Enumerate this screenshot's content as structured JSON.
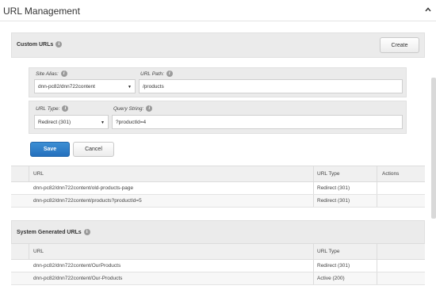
{
  "header": {
    "title": "URL Management"
  },
  "custom_urls": {
    "title": "Custom URLs",
    "create_label": "Create",
    "site_alias": {
      "label": "Site Alias:",
      "value": "dnn-pc82/dnn722content"
    },
    "url_path": {
      "label": "URL Path:",
      "value": "/products"
    },
    "url_type": {
      "label": "URL Type:",
      "value": "Redirect (301)"
    },
    "query_string": {
      "label": "Query String:",
      "value": "?productId=4"
    },
    "save_label": "Save",
    "cancel_label": "Cancel",
    "columns": [
      "URL",
      "URL Type",
      "Actions"
    ],
    "rows": [
      {
        "url": "dnn-pc82/dnn722content/old-products-page",
        "type": "Redirect (301)"
      },
      {
        "url": "dnn-pc82/dnn722content/products?productId=5",
        "type": "Redirect (301)"
      }
    ]
  },
  "system_urls": {
    "title": "System Generated URLs",
    "columns": [
      "URL",
      "URL Type"
    ],
    "rows": [
      {
        "url": "dnn-pc82/dnn722content/OurProducts",
        "type": "Redirect (301)"
      },
      {
        "url": "dnn-pc82/dnn722content/Our-Products",
        "type": "Active (200)"
      }
    ]
  },
  "colors": {
    "primary": "#2f7ec9",
    "panel_header": "#ebebeb"
  }
}
